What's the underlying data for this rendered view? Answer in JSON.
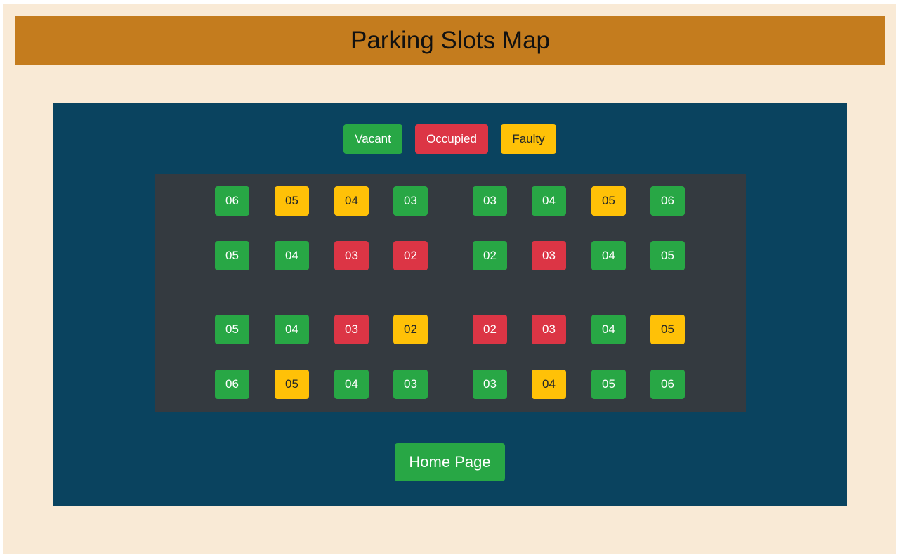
{
  "header": {
    "title": "Parking Slots Map"
  },
  "legend": {
    "vacant": "Vacant",
    "occupied": "Occupied",
    "faulty": "Faulty"
  },
  "colors": {
    "vacant": "#28a745",
    "occupied": "#dc3545",
    "faulty": "#ffc107",
    "header": "#c47c1e",
    "panel": "#0a435f",
    "lot": "#343a40"
  },
  "rows": [
    [
      {
        "label": "06",
        "status": "vacant"
      },
      {
        "label": "05",
        "status": "faulty"
      },
      {
        "label": "04",
        "status": "faulty"
      },
      {
        "label": "03",
        "status": "vacant"
      },
      {
        "label": "03",
        "status": "vacant"
      },
      {
        "label": "04",
        "status": "vacant"
      },
      {
        "label": "05",
        "status": "faulty"
      },
      {
        "label": "06",
        "status": "vacant"
      }
    ],
    [
      {
        "label": "05",
        "status": "vacant"
      },
      {
        "label": "04",
        "status": "vacant"
      },
      {
        "label": "03",
        "status": "occupied"
      },
      {
        "label": "02",
        "status": "occupied"
      },
      {
        "label": "02",
        "status": "vacant"
      },
      {
        "label": "03",
        "status": "occupied"
      },
      {
        "label": "04",
        "status": "vacant"
      },
      {
        "label": "05",
        "status": "vacant"
      }
    ],
    [
      {
        "label": "05",
        "status": "vacant"
      },
      {
        "label": "04",
        "status": "vacant"
      },
      {
        "label": "03",
        "status": "occupied"
      },
      {
        "label": "02",
        "status": "faulty"
      },
      {
        "label": "02",
        "status": "occupied"
      },
      {
        "label": "03",
        "status": "occupied"
      },
      {
        "label": "04",
        "status": "vacant"
      },
      {
        "label": "05",
        "status": "faulty"
      }
    ],
    [
      {
        "label": "06",
        "status": "vacant"
      },
      {
        "label": "05",
        "status": "faulty"
      },
      {
        "label": "04",
        "status": "vacant"
      },
      {
        "label": "03",
        "status": "vacant"
      },
      {
        "label": "03",
        "status": "vacant"
      },
      {
        "label": "04",
        "status": "faulty"
      },
      {
        "label": "05",
        "status": "vacant"
      },
      {
        "label": "06",
        "status": "vacant"
      }
    ]
  ],
  "home_button": "Home Page"
}
